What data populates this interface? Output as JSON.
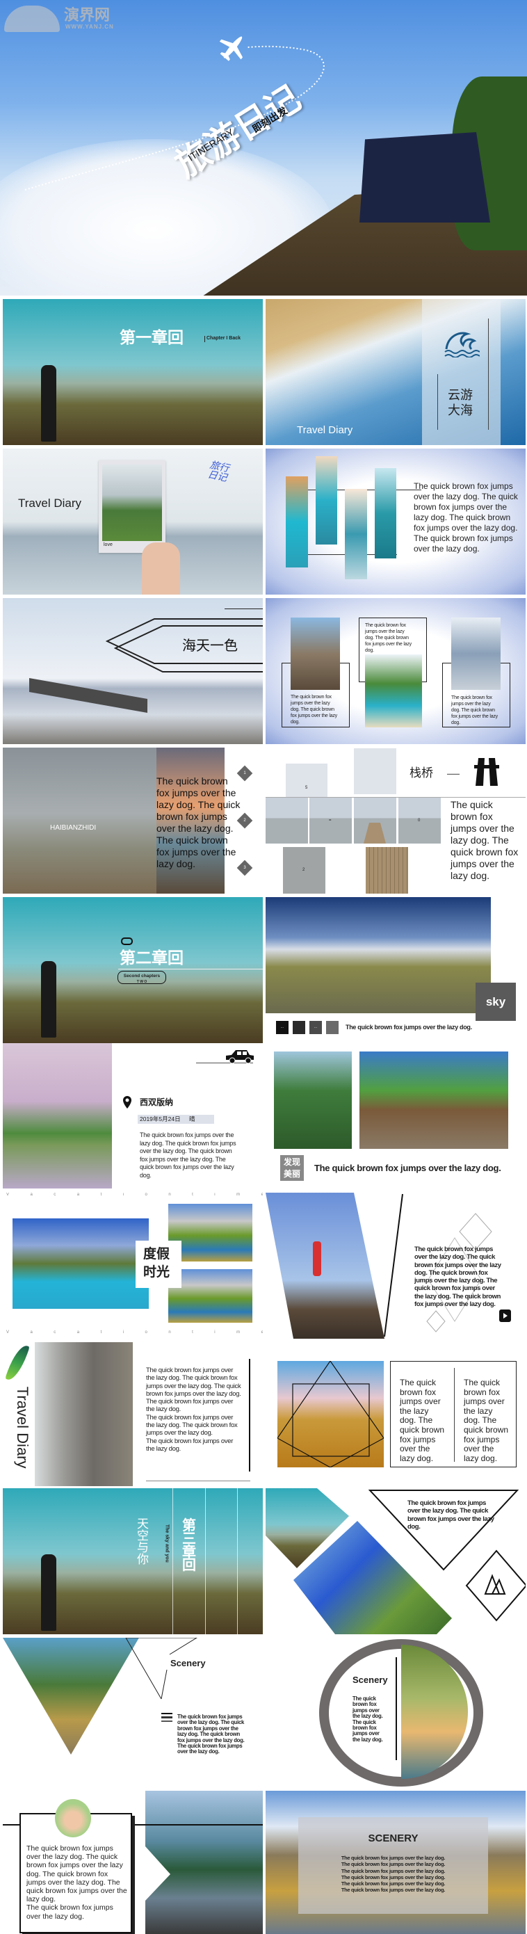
{
  "cover": {
    "logo_text": "演界网",
    "logo_url_text": "WWW.YANJ.CN",
    "title": "旅游日记",
    "subtitle_en": "ITINERARY",
    "subtitle_cn": "即刻出发"
  },
  "slides": {
    "chapter1": {
      "title": "第一章回",
      "tag": "Chapter I Back"
    },
    "sea": {
      "title": "云游大海",
      "label": "Travel Diary",
      "icon": "wave-icon"
    },
    "diary": {
      "title": "Travel Diary",
      "photo_caption": "love",
      "handwriting": "旅行日记"
    },
    "strips": {
      "text": "The quick brown fox jumps over the lazy dog. The quick brown fox jumps over the lazy dog. The quick brown fox jumps over the lazy dog. The quick brown fox jumps over the lazy dog."
    },
    "haitian": {
      "title": "海天一色"
    },
    "cards": {
      "items": [
        "The quick brown fox jumps over the lazy dog. The quick brown fox jumps over the lazy dog.",
        "The quick brown fox jumps over the lazy dog. The quick brown fox jumps over the lazy dog.",
        "The quick brown fox jumps over the lazy dog. The quick brown fox jumps over the lazy dog."
      ]
    },
    "haibian": {
      "label": "HAIBIANZHIDI",
      "text": "The quick brown fox jumps over the lazy dog. The quick brown fox jumps over the lazy dog. The quick brown fox jumps over the lazy dog.",
      "markers": [
        "1",
        "2",
        "3"
      ]
    },
    "zhanqiao": {
      "title": "栈桥",
      "dash": "—",
      "tile_labels": [
        "5",
        "=",
        "0",
        "2"
      ],
      "text": "The quick brown fox jumps over the lazy dog. The quick brown fox jumps over the lazy dog."
    },
    "chapter2": {
      "title": "第二章回",
      "pill": "Second chapters",
      "pill_sub": "T W O"
    },
    "sky": {
      "label": "sky",
      "swatch_labels": [
        "...",
        "",
        "...",
        ""
      ],
      "swatch_colors": [
        "#111111",
        "#2a2a2a",
        "#4a4a4a",
        "#6a6a6a"
      ],
      "text": "The quick brown fox jumps over the lazy dog."
    },
    "xishuang": {
      "place": "西双版纳",
      "date": "2019年5月24日",
      "weather": "晴",
      "text": "The quick brown fox jumps over the lazy dog. The quick brown fox jumps over the lazy dog. The quick brown fox jumps over the lazy dog. The quick brown fox jumps over the lazy dog."
    },
    "discover": {
      "badge": "发现美丽",
      "text": "The quick brown fox jumps over the lazy dog."
    },
    "vacation": {
      "title_line1": "度假",
      "title_line2": "时光",
      "spaced": [
        "V",
        "a",
        "c",
        "a",
        "t",
        "i",
        "o",
        "n",
        "t",
        "i",
        "m",
        "e"
      ]
    },
    "hiker": {
      "text": "The quick brown fox jumps over the lazy dog. The quick brown fox jumps over the lazy dog. The quick brown fox jumps over the lazy dog. The quick brown fox jumps over the lazy dog. The quick brown fox jumps over the lazy dog."
    },
    "diary2": {
      "title": "Travel Diary",
      "para1": "The quick brown fox jumps over the lazy dog. The quick brown fox jumps over the lazy dog. The quick brown fox jumps over the lazy dog. The quick brown fox jumps over the lazy dog.",
      "para2": "The quick brown fox jumps over the lazy dog. The quick brown fox jumps over the lazy dog.",
      "para3": "The quick brown fox jumps over the lazy dog."
    },
    "columns": {
      "col1": "The quick brown fox jumps over the lazy dog. The quick brown fox jumps over the lazy dog.",
      "col2": "The quick brown fox jumps over the lazy dog. The quick brown fox jumps over the lazy dog."
    },
    "chapter3": {
      "title": "第三章回",
      "sub_cn": "天空与你",
      "sub_en": "The sky and you"
    },
    "diamonds": {
      "text": "The quick brown fox jumps over the lazy dog. The quick brown fox jumps over the lazy dog."
    },
    "scenery1": {
      "title": "Scenery",
      "text": "The quick brown fox jumps over the lazy dog. The quick brown fox jumps over the lazy dog. The quick brown fox jumps over the lazy dog. The quick brown fox jumps over the lazy dog."
    },
    "scenery2": {
      "title": "Scenery",
      "text": "The quick brown fox jumps over the lazy dog. The quick brown fox jumps over the lazy dog."
    },
    "profile": {
      "text1": "The quick brown fox jumps over the lazy dog. The quick brown fox jumps over the lazy dog. The quick brown fox jumps over the lazy dog. The quick brown fox jumps over the lazy dog.",
      "text2": "The quick brown fox jumps over the lazy dog."
    },
    "scenery3": {
      "title": "SCENERY",
      "lines": [
        "The quick brown fox jumps over the lazy dog.",
        "The quick brown fox jumps over the lazy dog.",
        "The quick brown fox jumps over the lazy dog.",
        "The quick brown fox jumps over the lazy dog.",
        "The quick brown fox jumps over the lazy dog.",
        "The quick brown fox jumps over the lazy dog."
      ]
    }
  }
}
